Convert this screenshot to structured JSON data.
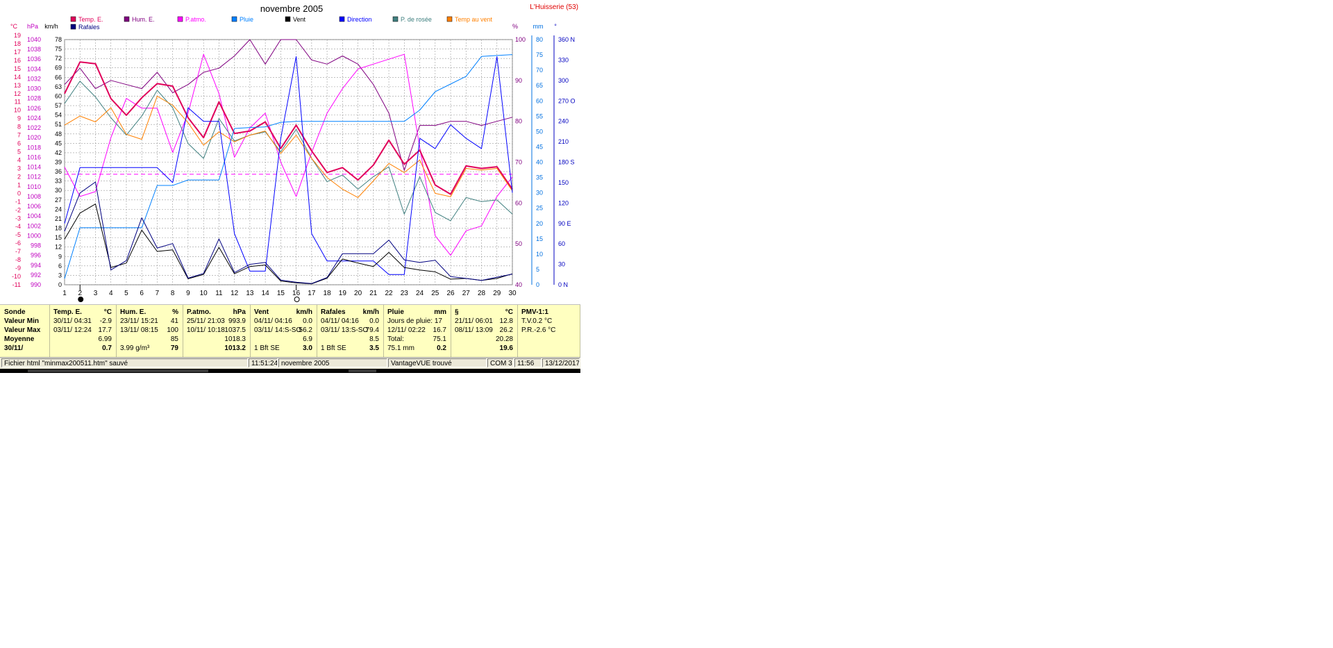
{
  "chart_data": {
    "type": "line",
    "title": "novembre 2005",
    "station": "L'Huisserie (53)",
    "x": [
      1,
      2,
      3,
      4,
      5,
      6,
      7,
      8,
      9,
      10,
      11,
      12,
      13,
      14,
      15,
      16,
      17,
      18,
      19,
      20,
      21,
      22,
      23,
      24,
      25,
      26,
      27,
      28,
      29,
      30
    ],
    "xlim": [
      1,
      30
    ],
    "unit_labels": [
      "°C",
      "hPa",
      "km/h",
      "%",
      "mm",
      "°"
    ],
    "axes": {
      "temp": {
        "unit": "°C",
        "min": -11,
        "max": 19,
        "step": 1,
        "color": "#e0005a"
      },
      "press": {
        "unit": "hPa",
        "min": 990,
        "max": 1040,
        "step": 2,
        "color": "#c000c0"
      },
      "wind": {
        "unit": "km/h",
        "min": 0,
        "max": 78,
        "step": 3,
        "color": "#000000"
      },
      "hum": {
        "unit": "%",
        "min": 40,
        "max": 100,
        "step": 10,
        "color": "#800080"
      },
      "rain": {
        "unit": "mm",
        "min": 0,
        "max": 80,
        "step": 5,
        "color": "#0070e0"
      },
      "dir": {
        "unit": "°",
        "min": 0,
        "max": 360,
        "step": 30,
        "color": "#0000c0",
        "compass": {
          "0": "N",
          "90": "E",
          "180": "S",
          "270": "O",
          "360": "N"
        }
      }
    },
    "grid": true,
    "moon_phases": [
      {
        "day": 2,
        "phase": "new"
      },
      {
        "day": 16,
        "phase": "full"
      }
    ],
    "legend": [
      {
        "name": "Temp. E.",
        "color": "#e0005a"
      },
      {
        "name": "Hum. E.",
        "color": "#800080"
      },
      {
        "name": "P.atmo.",
        "color": "#ff00ff"
      },
      {
        "name": "Pluie",
        "color": "#0080ff"
      },
      {
        "name": "Vent",
        "color": "#000000"
      },
      {
        "name": "Direction",
        "color": "#0000ff"
      },
      {
        "name": "P. de rosée",
        "color": "#408080"
      },
      {
        "name": "Temp au vent",
        "color": "#ff8000"
      },
      {
        "name": "Rafales",
        "color": "#000080"
      }
    ],
    "series": [
      {
        "name": "Hum. E.",
        "axis": "hum",
        "color": "#800080",
        "width": 1,
        "values": [
          89,
          93,
          88,
          90,
          89,
          88,
          92,
          87,
          89,
          92,
          93,
          96,
          100,
          94,
          100,
          100,
          95,
          94,
          96,
          94,
          89,
          82,
          68,
          79,
          79,
          80,
          80,
          79,
          80,
          81
        ]
      },
      {
        "name": "P.atmo.",
        "axis": "press",
        "color": "#ff00ff",
        "width": 1,
        "values": [
          1014,
          1008,
          1009,
          1020,
          1028,
          1026,
          1026,
          1017,
          1025,
          1037,
          1029,
          1016,
          1022,
          1025,
          1015,
          1008,
          1017,
          1025,
          1030,
          1034,
          1035,
          1036,
          1037,
          1018,
          1000,
          996,
          1001,
          1002,
          1008,
          1012
        ]
      },
      {
        "name": "Temp. E.",
        "axis": "temp",
        "color": "#e0005a",
        "width": 2,
        "values": [
          12.0,
          15.8,
          15.6,
          11.4,
          9.4,
          11.5,
          13.2,
          12.9,
          9.1,
          6.7,
          11.0,
          7.2,
          7.5,
          8.6,
          5.4,
          8.2,
          5.1,
          2.5,
          3.1,
          1.6,
          3.4,
          6.4,
          3.5,
          5.2,
          1.0,
          -0.1,
          3.3,
          3.0,
          3.2,
          0.5
        ]
      },
      {
        "name": "P. de rosée",
        "axis": "temp",
        "color": "#408080",
        "width": 1,
        "values": [
          10.8,
          13.5,
          11.6,
          9.1,
          7.0,
          9.3,
          12.4,
          10.3,
          6.0,
          4.2,
          9.0,
          6.3,
          7.0,
          7.4,
          5.0,
          7.7,
          4.2,
          1.4,
          2.2,
          0.5,
          2.0,
          3.2,
          -2.5,
          2.0,
          -2.3,
          -3.3,
          -0.5,
          -1.0,
          -0.8,
          -2.5
        ]
      },
      {
        "name": "Temp au vent",
        "axis": "temp",
        "color": "#ff8000",
        "width": 1,
        "values": [
          8.2,
          9.3,
          8.6,
          10.3,
          7.1,
          6.5,
          11.7,
          10.6,
          8.5,
          5.8,
          7.4,
          6.2,
          7.0,
          7.5,
          4.8,
          7.0,
          4.2,
          1.9,
          0.5,
          -0.5,
          1.5,
          3.6,
          2.5,
          4.0,
          0.0,
          -0.4,
          3.0,
          2.8,
          3.0,
          0.3
        ]
      },
      {
        "name": "Pluie",
        "axis": "rain",
        "color": "#0080ff",
        "width": 1,
        "values": [
          2.0,
          18.6,
          18.6,
          18.6,
          18.6,
          18.6,
          32.4,
          32.4,
          34.2,
          34.2,
          34.2,
          51.0,
          51.3,
          51.5,
          53.0,
          53.3,
          53.3,
          53.3,
          53.3,
          53.3,
          53.3,
          53.3,
          53.3,
          57.0,
          63.0,
          65.5,
          68.0,
          74.5,
          74.8,
          75.1
        ]
      },
      {
        "name": "Direction",
        "axis": "dir",
        "color": "#0000ff",
        "width": 1,
        "values": [
          90,
          172,
          172,
          172,
          172,
          172,
          172,
          150,
          260,
          240,
          240,
          75,
          20,
          20,
          215,
          335,
          75,
          35,
          35,
          35,
          35,
          15,
          15,
          215,
          200,
          235,
          215,
          200,
          335,
          135
        ]
      },
      {
        "name": "Vent",
        "axis": "wind",
        "color": "#000000",
        "width": 1,
        "values": [
          14.5,
          22.8,
          25.7,
          5.5,
          6.9,
          17.4,
          10.6,
          11.1,
          1.9,
          3.3,
          11.9,
          3.5,
          5.8,
          6.3,
          1.2,
          0.6,
          0.3,
          2.1,
          8.2,
          6.9,
          5.8,
          10.3,
          5.5,
          4.7,
          4.1,
          1.8,
          2.0,
          1.4,
          2.0,
          3.5
        ]
      },
      {
        "name": "Rafales",
        "axis": "wind",
        "color": "#000080",
        "width": 1,
        "values": [
          17.0,
          29.2,
          32.7,
          4.7,
          7.7,
          21.3,
          11.7,
          13.1,
          2.1,
          3.6,
          14.6,
          3.9,
          6.5,
          7.1,
          1.5,
          0.8,
          0.4,
          2.3,
          9.9,
          9.9,
          9.9,
          14.2,
          7.9,
          7.1,
          7.8,
          2.6,
          2.0,
          1.4,
          2.4,
          3.4
        ]
      }
    ],
    "reference_lines": [
      {
        "axis": "temp",
        "value": 2.3,
        "color": "#ff00ff",
        "dashed": true
      }
    ]
  },
  "stats": {
    "row_labels": [
      "Sonde",
      "Valeur Min",
      "Valeur Max",
      "Moyenne",
      "30/11/"
    ],
    "columns": [
      {
        "title": "Temp. E.",
        "unit": "°C",
        "rows": [
          {
            "t": "30/11/  04:31",
            "v": "-2.9"
          },
          {
            "t": "03/11/  12:24",
            "v": "17.7"
          },
          {
            "t": "",
            "v": "6.99"
          },
          {
            "t": "",
            "v": "0.7"
          }
        ]
      },
      {
        "title": "Hum. E.",
        "unit": "%",
        "rows": [
          {
            "t": "23/11/  15:21",
            "v": "41"
          },
          {
            "t": "13/11/  08:15",
            "v": "100"
          },
          {
            "t": "",
            "v": "85"
          },
          {
            "t": "3.99 g/m³",
            "v": "79"
          }
        ]
      },
      {
        "title": "P.atmo.",
        "unit": "hPa",
        "rows": [
          {
            "t": "25/11/  21:03",
            "v": "993.9"
          },
          {
            "t": "10/11/  10:18",
            "v": "1037.5"
          },
          {
            "t": "",
            "v": "1018.3"
          },
          {
            "t": "",
            "v": "1013.2"
          }
        ]
      },
      {
        "title": "Vent",
        "unit": "km/h",
        "rows": [
          {
            "t": "04/11/  04:16",
            "v": "0.0"
          },
          {
            "t": "03/11/  14:S-SO",
            "v": "56.2"
          },
          {
            "t": "",
            "v": "6.9"
          },
          {
            "t": "1 Bft SE",
            "v": "3.0"
          }
        ]
      },
      {
        "title": "Rafales",
        "unit": "km/h",
        "rows": [
          {
            "t": "04/11/  04:16",
            "v": "0.0"
          },
          {
            "t": "03/11/  13:S-SO",
            "v": "79.4"
          },
          {
            "t": "",
            "v": "8.5"
          },
          {
            "t": "1 Bft SE",
            "v": "3.5"
          }
        ]
      },
      {
        "title": "Pluie",
        "unit": "mm",
        "rows": [
          {
            "t": "Jours de pluie: 17",
            "v": ""
          },
          {
            "t": "12/11/  02:22",
            "v": "16.7"
          },
          {
            "t": "Total:",
            "v": "75.1"
          },
          {
            "t": "75.1 mm",
            "v": "0.2"
          }
        ]
      },
      {
        "title": "§",
        "unit": "°C",
        "rows": [
          {
            "t": "21/11/  06:01",
            "v": "12.8"
          },
          {
            "t": "08/11/  13:09",
            "v": "26.2"
          },
          {
            "t": "",
            "v": "20.28"
          },
          {
            "t": "",
            "v": "19.6"
          }
        ]
      },
      {
        "title": "PMV-1:1",
        "unit": "",
        "rows": [
          {
            "t": "T.V.0.2 °C",
            "v": ""
          },
          {
            "t": "P.R.-2.6 °C",
            "v": ""
          },
          {
            "t": "",
            "v": ""
          },
          {
            "t": "",
            "v": ""
          }
        ]
      }
    ]
  },
  "status_bar": {
    "message": "Fichier html  \"minmax200511.htm\"  sauvé",
    "time": "11:51:24",
    "month": "novembre 2005",
    "device": "VantageVUE trouvé",
    "port": "COM 3",
    "clock": "11:56",
    "date": "13/12/2017"
  }
}
